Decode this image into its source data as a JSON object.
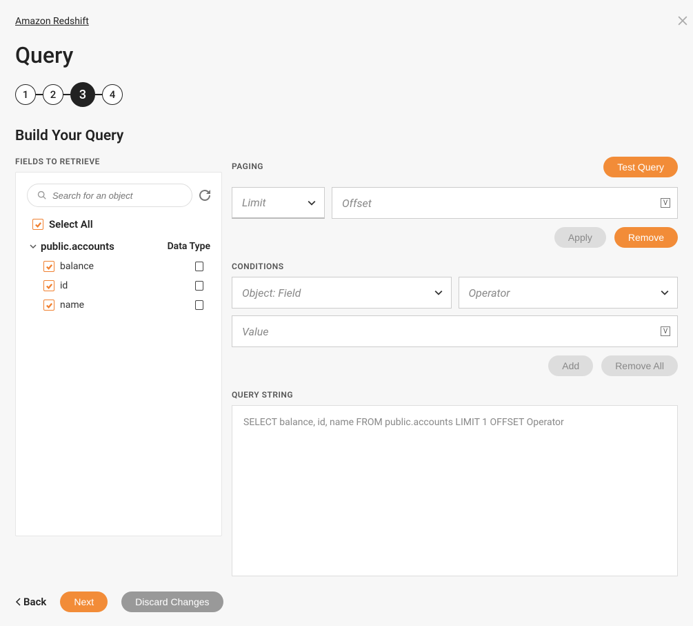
{
  "breadcrumb": {
    "label": "Amazon Redshift"
  },
  "page_title": "Query",
  "stepper": {
    "steps": [
      "1",
      "2",
      "3",
      "4"
    ],
    "active_index": 2
  },
  "section_title": "Build Your Query",
  "fields": {
    "label": "Fields to Retrieve",
    "search_placeholder": "Search for an object",
    "select_all_label": "Select All",
    "table_name": "public.accounts",
    "data_type_header": "Data Type",
    "rows": [
      {
        "name": "balance",
        "checked": true
      },
      {
        "name": "id",
        "checked": true
      },
      {
        "name": "name",
        "checked": true
      }
    ]
  },
  "paging": {
    "label": "Paging",
    "limit_placeholder": "Limit",
    "offset_placeholder": "Offset",
    "apply_label": "Apply",
    "remove_label": "Remove"
  },
  "conditions": {
    "label": "Conditions",
    "object_field_placeholder": "Object: Field",
    "operator_placeholder": "Operator",
    "value_placeholder": "Value",
    "add_label": "Add",
    "remove_all_label": "Remove All"
  },
  "query_string": {
    "label": "Query String",
    "value": "SELECT balance, id, name FROM public.accounts  LIMIT 1  OFFSET Operator"
  },
  "test_query_label": "Test Query",
  "footer": {
    "back_label": "Back",
    "next_label": "Next",
    "discard_label": "Discard Changes"
  }
}
